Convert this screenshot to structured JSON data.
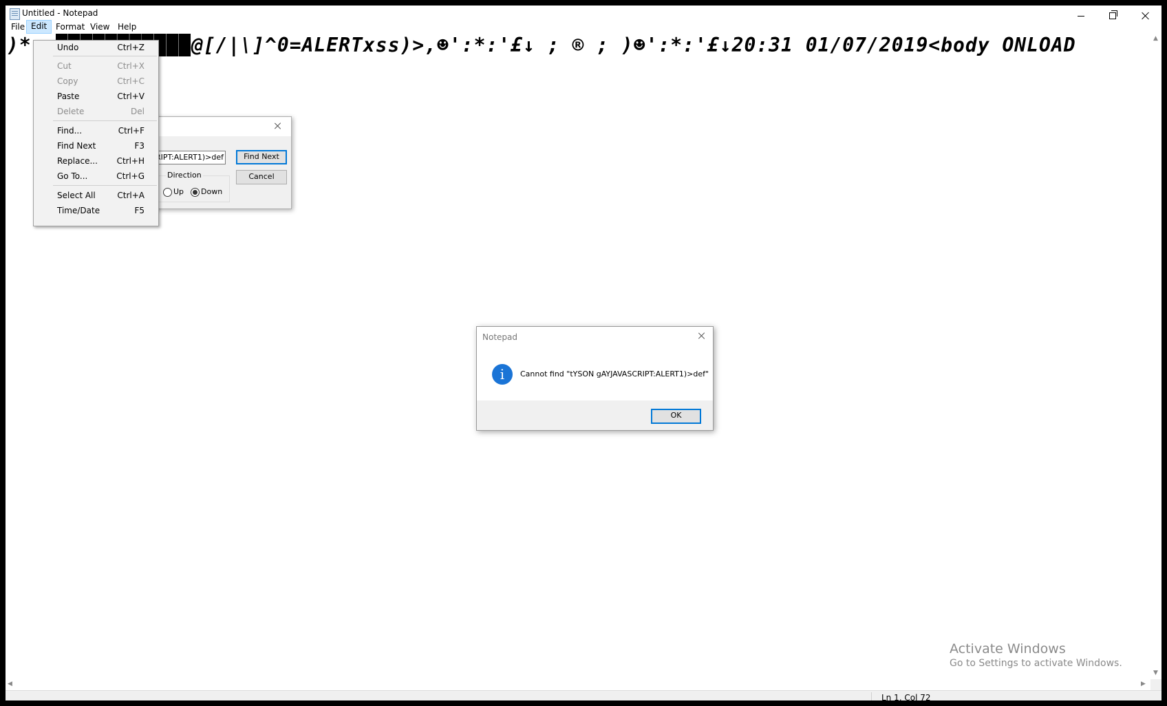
{
  "window": {
    "title": "Untitled - Notepad"
  },
  "menubar": {
    "items": [
      "File",
      "Edit",
      "Format",
      "View",
      "Help"
    ],
    "active": "Edit"
  },
  "editor": {
    "text": ")*  =███████████@[/|\\]^0=ALERTxss)>,☻':*:'£↓ ; ® ; )☻':*:'£↓20:31 01/07/2019<body ONLOAD"
  },
  "edit_menu": {
    "items": [
      {
        "label": "Undo",
        "shortcut": "Ctrl+Z",
        "enabled": true
      },
      {
        "label": "Cut",
        "shortcut": "Ctrl+X",
        "enabled": false
      },
      {
        "label": "Copy",
        "shortcut": "Ctrl+C",
        "enabled": false
      },
      {
        "label": "Paste",
        "shortcut": "Ctrl+V",
        "enabled": true
      },
      {
        "label": "Delete",
        "shortcut": "Del",
        "enabled": false
      },
      {
        "label": "Find...",
        "shortcut": "Ctrl+F",
        "enabled": true
      },
      {
        "label": "Find Next",
        "shortcut": "F3",
        "enabled": true
      },
      {
        "label": "Replace...",
        "shortcut": "Ctrl+H",
        "enabled": true
      },
      {
        "label": "Go To...",
        "shortcut": "Ctrl+G",
        "enabled": true
      },
      {
        "label": "Select All",
        "shortcut": "Ctrl+A",
        "enabled": true
      },
      {
        "label": "Time/Date",
        "shortcut": "F5",
        "enabled": true
      }
    ]
  },
  "find_dialog": {
    "search_value": "CRIPT:ALERT1)>def",
    "find_next_label": "Find Next",
    "cancel_label": "Cancel",
    "direction_label": "Direction",
    "up_label": "Up",
    "down_label": "Down",
    "selected_direction": "Down"
  },
  "message_dialog": {
    "title": "Notepad",
    "message": "Cannot find \"tYSON gAYJAVASCRIPT:ALERT1)>def\"",
    "ok_label": "OK"
  },
  "watermark": {
    "title": "Activate Windows",
    "subtitle": "Go to Settings to activate Windows."
  },
  "statusbar": {
    "position": "Ln 1, Col 72"
  }
}
